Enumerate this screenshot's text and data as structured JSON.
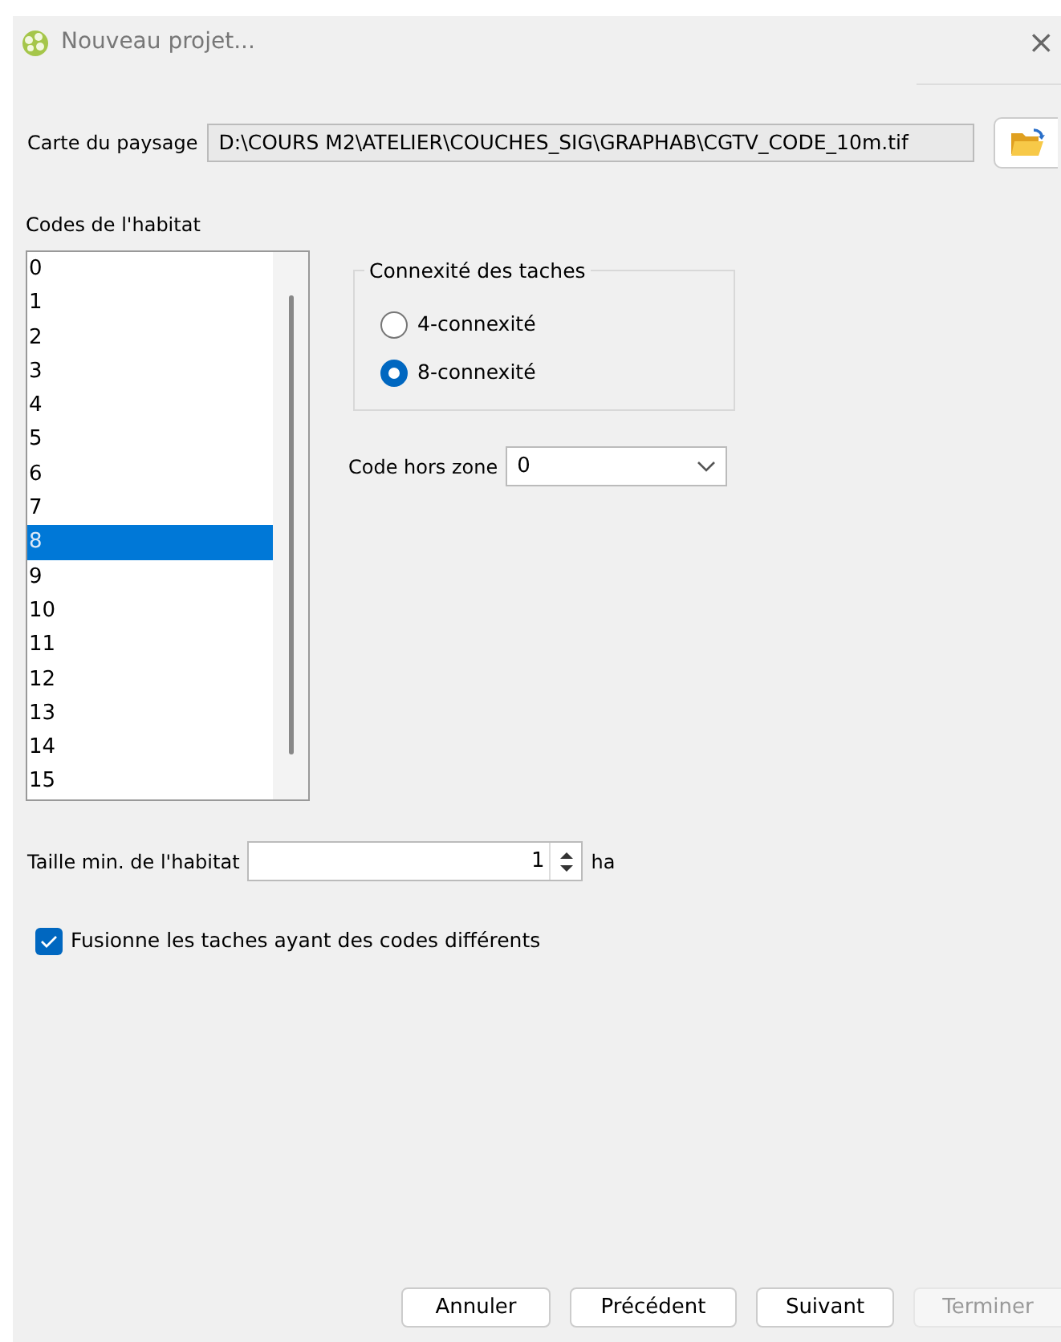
{
  "window": {
    "title": "Nouveau projet...",
    "close": "×"
  },
  "landscape_map": {
    "label": "Carte du paysage",
    "value": "D:\\COURS M2\\ATELIER\\COUCHES_SIG\\GRAPHAB\\CGTV_CODE_10m.tif"
  },
  "habitat_codes": {
    "label": "Codes de l'habitat",
    "items": [
      {
        "text": "0",
        "selected": false
      },
      {
        "text": "1",
        "selected": false
      },
      {
        "text": "2",
        "selected": false
      },
      {
        "text": "3",
        "selected": false
      },
      {
        "text": "4",
        "selected": false
      },
      {
        "text": "5",
        "selected": false
      },
      {
        "text": "6",
        "selected": false
      },
      {
        "text": "7",
        "selected": false
      },
      {
        "text": "8",
        "selected": true
      },
      {
        "text": "9",
        "selected": false
      },
      {
        "text": "10",
        "selected": false
      },
      {
        "text": "11",
        "selected": false
      },
      {
        "text": "12",
        "selected": false
      },
      {
        "text": "13",
        "selected": false
      },
      {
        "text": "14",
        "selected": false
      },
      {
        "text": "15",
        "selected": false
      }
    ]
  },
  "connectivity": {
    "title": "Connexité des taches",
    "options": [
      {
        "label": "4-connexité",
        "selected": false
      },
      {
        "label": "8-connexité",
        "selected": true
      }
    ]
  },
  "nodata_code": {
    "label": "Code hors zone",
    "value": "0"
  },
  "min_habitat_size": {
    "label": "Taille min. de l'habitat",
    "value": "1",
    "unit": "ha"
  },
  "merge_patches": {
    "label": "Fusionne les taches ayant des codes différents",
    "checked": true
  },
  "buttons": [
    {
      "label": "Annuler",
      "disabled": false
    },
    {
      "label": "Précédent",
      "disabled": false
    },
    {
      "label": "Suivant",
      "disabled": false
    },
    {
      "label": "Terminer",
      "disabled": true
    }
  ]
}
